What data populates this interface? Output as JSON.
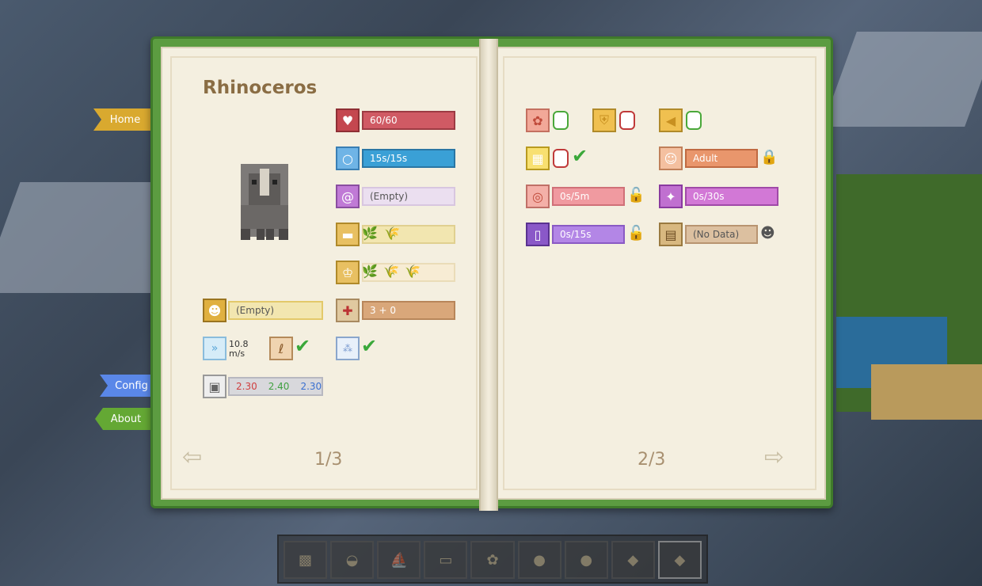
{
  "tabs": {
    "home": "Home",
    "config": "Config",
    "about": "About"
  },
  "left_page": {
    "title": "Rhinoceros",
    "health": "60/60",
    "air": "15s/15s",
    "effect": "(Empty)",
    "food_count": "",
    "breed": "3 + 0",
    "slot": "(Empty)",
    "speed": "10.8",
    "speed_unit": "m/s",
    "size_x": "2.30",
    "size_y": "2.40",
    "size_z": "2.30",
    "page": "1/3"
  },
  "right_page": {
    "age": "Adult",
    "breed_cooldown": "0s/5m",
    "anger": "0s/30s",
    "freeze": "0s/15s",
    "data": "(No Data)",
    "page": "2/3"
  },
  "colors": {
    "health": "#d05a64",
    "air": "#3aa0d6",
    "effect": "#ebdff0",
    "food": "#f2e6b0",
    "orange": "#e9966c",
    "pink": "#f09aa0",
    "purple": "#d278d6",
    "violet": "#b386e6",
    "tan": "#d9a77a"
  },
  "hotbar": [
    "grass-icon",
    "bread-icon",
    "boat-icon",
    "book-icon",
    "wheat-icon",
    "egg-icon",
    "gray-egg-icon",
    "diamond-icon",
    "stone-icon"
  ]
}
